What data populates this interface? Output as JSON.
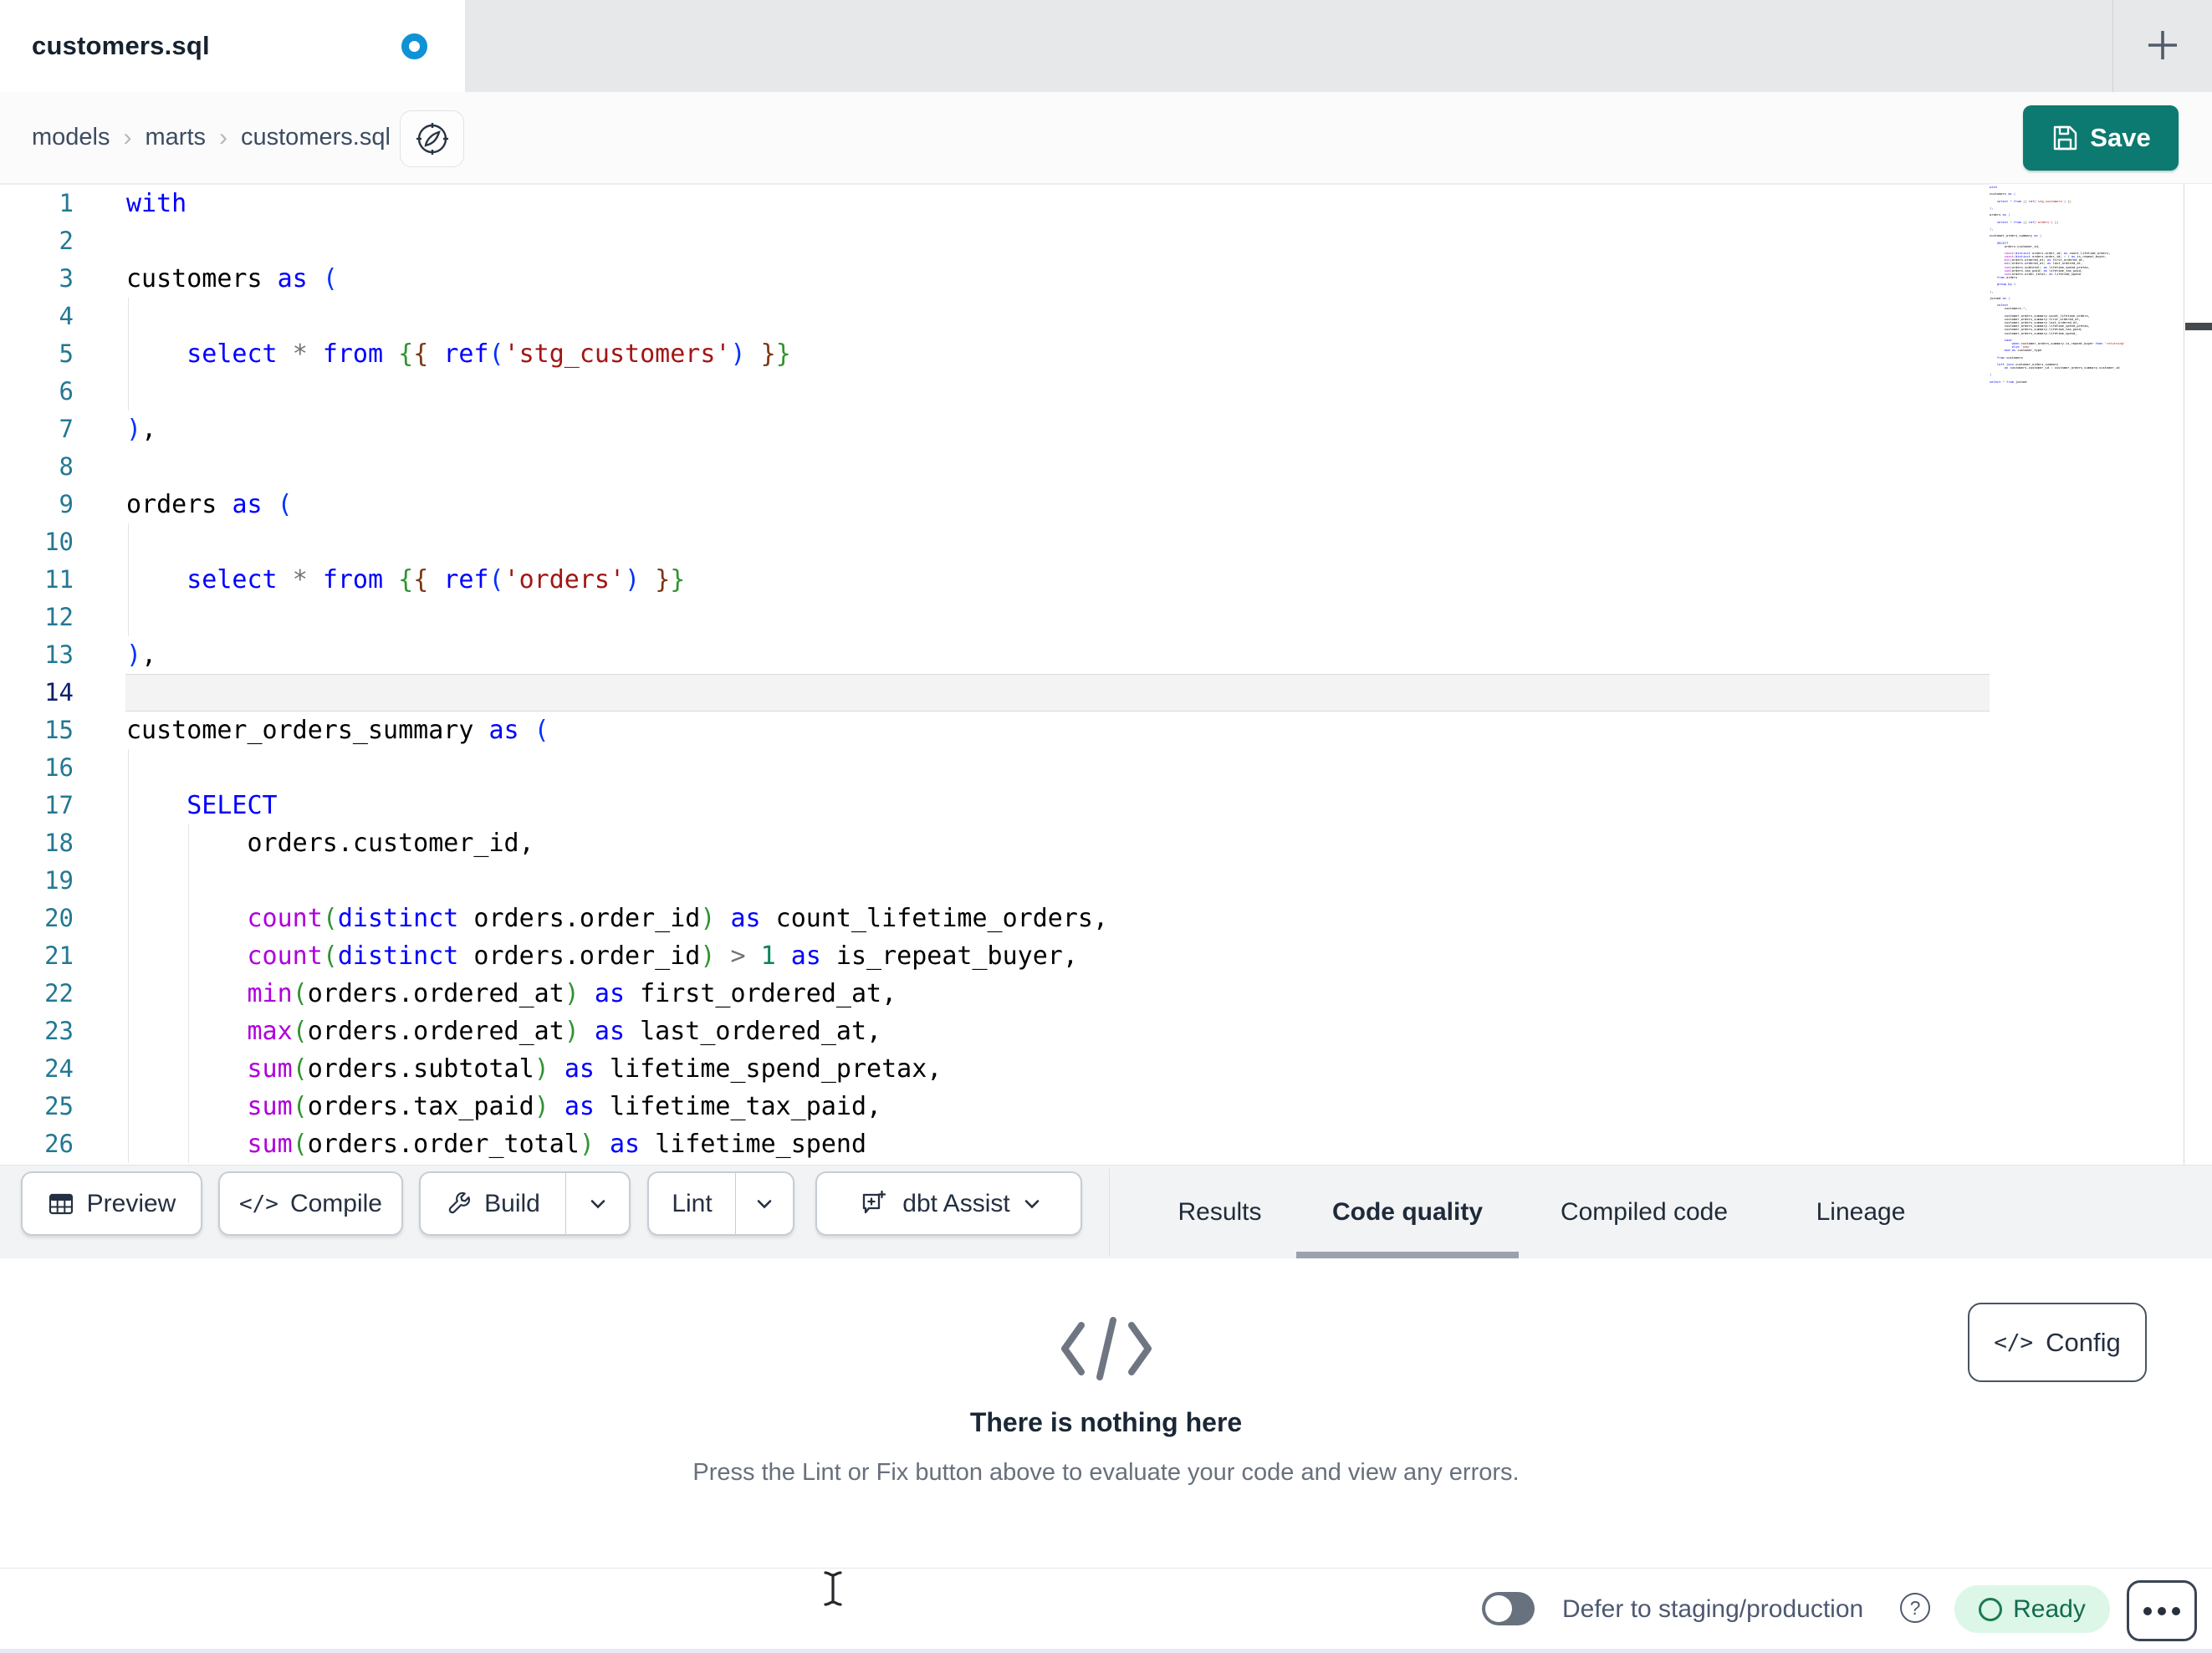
{
  "tabbar": {
    "tab_title": "customers.sql"
  },
  "breadcrumb": {
    "items": [
      "models",
      "marts",
      "customers.sql"
    ],
    "separator": "›"
  },
  "save_button": {
    "label": "Save"
  },
  "toolbar": {
    "preview_label": "Preview",
    "compile_label": "Compile",
    "compile_glyph": "</>",
    "build_label": "Build",
    "lint_label": "Lint",
    "assist_label": "dbt Assist"
  },
  "tabs": [
    {
      "label": "Results",
      "active": false
    },
    {
      "label": "Code quality",
      "active": true
    },
    {
      "label": "Compiled code",
      "active": false
    },
    {
      "label": "Lineage",
      "active": false
    }
  ],
  "empty_state": {
    "title": "There is nothing here",
    "subtitle": "Press the Lint or Fix button above to evaluate your code and view any errors."
  },
  "config_button": {
    "label": "Config",
    "glyph": "</>"
  },
  "statusbar": {
    "defer_label": "Defer to staging/production",
    "help_glyph": "?",
    "ready_label": "Ready"
  },
  "colors": {
    "accent_teal": "#0c7a70",
    "dirty_dot_blue": "#0f93d6",
    "ready_bg": "#dcf7e7",
    "ready_text": "#116b50",
    "active_tab_underline": "#9aa2ac",
    "line_number": "#237893",
    "active_line_number": "#0b216f"
  },
  "editor": {
    "token_colors": {
      "kw": "#0000ff",
      "fn": "#af00db",
      "str": "#a31515",
      "num": "#098658",
      "op": "#737373",
      "id": "#000000",
      "b1": "#0431fa",
      "b2": "#319331",
      "b3": "#7b3814"
    },
    "lines": [
      {
        "n": 1,
        "g": 0,
        "t": [
          [
            "kw",
            "with"
          ]
        ]
      },
      {
        "n": 2,
        "g": 0,
        "t": []
      },
      {
        "n": 3,
        "g": 0,
        "t": [
          [
            "id",
            "customers "
          ],
          [
            "kw",
            "as"
          ],
          [
            "id",
            " "
          ],
          [
            "b1",
            "("
          ]
        ]
      },
      {
        "n": 4,
        "g": 1,
        "t": []
      },
      {
        "n": 5,
        "g": 1,
        "t": [
          [
            "id",
            "    "
          ],
          [
            "kw",
            "select"
          ],
          [
            "id",
            " "
          ],
          [
            "op",
            "*"
          ],
          [
            "id",
            " "
          ],
          [
            "kw",
            "from"
          ],
          [
            "id",
            " "
          ],
          [
            "b2",
            "{"
          ],
          [
            "b3",
            "{"
          ],
          [
            "id",
            " "
          ],
          [
            "kw",
            "ref"
          ],
          [
            "b1",
            "("
          ],
          [
            "str",
            "'stg_customers'"
          ],
          [
            "b1",
            ")"
          ],
          [
            "id",
            " "
          ],
          [
            "b3",
            "}"
          ],
          [
            "b2",
            "}"
          ]
        ]
      },
      {
        "n": 6,
        "g": 1,
        "t": []
      },
      {
        "n": 7,
        "g": 0,
        "t": [
          [
            "b1",
            ")"
          ],
          [
            "id",
            ","
          ]
        ]
      },
      {
        "n": 8,
        "g": 0,
        "t": []
      },
      {
        "n": 9,
        "g": 0,
        "t": [
          [
            "id",
            "orders "
          ],
          [
            "kw",
            "as"
          ],
          [
            "id",
            " "
          ],
          [
            "b1",
            "("
          ]
        ]
      },
      {
        "n": 10,
        "g": 1,
        "t": []
      },
      {
        "n": 11,
        "g": 1,
        "t": [
          [
            "id",
            "    "
          ],
          [
            "kw",
            "select"
          ],
          [
            "id",
            " "
          ],
          [
            "op",
            "*"
          ],
          [
            "id",
            " "
          ],
          [
            "kw",
            "from"
          ],
          [
            "id",
            " "
          ],
          [
            "b2",
            "{"
          ],
          [
            "b3",
            "{"
          ],
          [
            "id",
            " "
          ],
          [
            "kw",
            "ref"
          ],
          [
            "b1",
            "("
          ],
          [
            "str",
            "'orders'"
          ],
          [
            "b1",
            ")"
          ],
          [
            "id",
            " "
          ],
          [
            "b3",
            "}"
          ],
          [
            "b2",
            "}"
          ]
        ]
      },
      {
        "n": 12,
        "g": 1,
        "t": []
      },
      {
        "n": 13,
        "g": 0,
        "t": [
          [
            "b1",
            ")"
          ],
          [
            "id",
            ","
          ]
        ]
      },
      {
        "n": 14,
        "g": 0,
        "active": true,
        "t": []
      },
      {
        "n": 15,
        "g": 0,
        "t": [
          [
            "id",
            "customer_orders_summary "
          ],
          [
            "kw",
            "as"
          ],
          [
            "id",
            " "
          ],
          [
            "b1",
            "("
          ]
        ]
      },
      {
        "n": 16,
        "g": 1,
        "t": []
      },
      {
        "n": 17,
        "g": 1,
        "t": [
          [
            "id",
            "    "
          ],
          [
            "kw",
            "SELECT"
          ]
        ]
      },
      {
        "n": 18,
        "g": 2,
        "t": [
          [
            "id",
            "        orders.customer_id,"
          ]
        ]
      },
      {
        "n": 19,
        "g": 2,
        "t": []
      },
      {
        "n": 20,
        "g": 2,
        "t": [
          [
            "id",
            "        "
          ],
          [
            "fn",
            "count"
          ],
          [
            "b2",
            "("
          ],
          [
            "kw",
            "distinct"
          ],
          [
            "id",
            " orders.order_id"
          ],
          [
            "b2",
            ")"
          ],
          [
            "id",
            " "
          ],
          [
            "kw",
            "as"
          ],
          [
            "id",
            " count_lifetime_orders,"
          ]
        ]
      },
      {
        "n": 21,
        "g": 2,
        "t": [
          [
            "id",
            "        "
          ],
          [
            "fn",
            "count"
          ],
          [
            "b2",
            "("
          ],
          [
            "kw",
            "distinct"
          ],
          [
            "id",
            " orders.order_id"
          ],
          [
            "b2",
            ")"
          ],
          [
            "id",
            " "
          ],
          [
            "op",
            ">"
          ],
          [
            "id",
            " "
          ],
          [
            "num",
            "1"
          ],
          [
            "id",
            " "
          ],
          [
            "kw",
            "as"
          ],
          [
            "id",
            " is_repeat_buyer,"
          ]
        ]
      },
      {
        "n": 22,
        "g": 2,
        "t": [
          [
            "id",
            "        "
          ],
          [
            "fn",
            "min"
          ],
          [
            "b2",
            "("
          ],
          [
            "id",
            "orders.ordered_at"
          ],
          [
            "b2",
            ")"
          ],
          [
            "id",
            " "
          ],
          [
            "kw",
            "as"
          ],
          [
            "id",
            " first_ordered_at,"
          ]
        ]
      },
      {
        "n": 23,
        "g": 2,
        "t": [
          [
            "id",
            "        "
          ],
          [
            "fn",
            "max"
          ],
          [
            "b2",
            "("
          ],
          [
            "id",
            "orders.ordered_at"
          ],
          [
            "b2",
            ")"
          ],
          [
            "id",
            " "
          ],
          [
            "kw",
            "as"
          ],
          [
            "id",
            " last_ordered_at,"
          ]
        ]
      },
      {
        "n": 24,
        "g": 2,
        "t": [
          [
            "id",
            "        "
          ],
          [
            "fn",
            "sum"
          ],
          [
            "b2",
            "("
          ],
          [
            "id",
            "orders.subtotal"
          ],
          [
            "b2",
            ")"
          ],
          [
            "id",
            " "
          ],
          [
            "kw",
            "as"
          ],
          [
            "id",
            " lifetime_spend_pretax,"
          ]
        ]
      },
      {
        "n": 25,
        "g": 2,
        "t": [
          [
            "id",
            "        "
          ],
          [
            "fn",
            "sum"
          ],
          [
            "b2",
            "("
          ],
          [
            "id",
            "orders.tax_paid"
          ],
          [
            "b2",
            ")"
          ],
          [
            "id",
            " "
          ],
          [
            "kw",
            "as"
          ],
          [
            "id",
            " lifetime_tax_paid,"
          ]
        ]
      },
      {
        "n": 26,
        "g": 2,
        "t": [
          [
            "id",
            "        "
          ],
          [
            "fn",
            "sum"
          ],
          [
            "b2",
            "("
          ],
          [
            "id",
            "orders.order_total"
          ],
          [
            "b2",
            ")"
          ],
          [
            "id",
            " "
          ],
          [
            "kw",
            "as"
          ],
          [
            "id",
            " lifetime_spend"
          ]
        ]
      }
    ],
    "minimap_extra": [
      {
        "t": [
          [
            "id",
            "    "
          ],
          [
            "kw",
            "from"
          ],
          [
            "id",
            " orders"
          ]
        ]
      },
      {
        "t": []
      },
      {
        "t": [
          [
            "id",
            "    "
          ],
          [
            "kw",
            "group"
          ],
          [
            "id",
            " "
          ],
          [
            "kw",
            "by"
          ],
          [
            "id",
            " "
          ],
          [
            "num",
            "1"
          ]
        ]
      },
      {
        "t": []
      },
      {
        "t": [
          [
            "b1",
            ")"
          ],
          [
            "id",
            ","
          ]
        ]
      },
      {
        "t": []
      },
      {
        "t": [
          [
            "id",
            "joined "
          ],
          [
            "kw",
            "as"
          ],
          [
            "id",
            " "
          ],
          [
            "b1",
            "("
          ]
        ]
      },
      {
        "t": []
      },
      {
        "t": [
          [
            "id",
            "    "
          ],
          [
            "kw",
            "select"
          ]
        ]
      },
      {
        "t": [
          [
            "id",
            "        customers."
          ],
          [
            "op",
            "*"
          ],
          [
            "id",
            ","
          ]
        ]
      },
      {
        "t": []
      },
      {
        "t": [
          [
            "id",
            "        customer_orders_summary.count_lifetime_orders,"
          ]
        ]
      },
      {
        "t": [
          [
            "id",
            "        customer_orders_summary.first_ordered_at,"
          ]
        ]
      },
      {
        "t": [
          [
            "id",
            "        customer_orders_summary.last_ordered_at,"
          ]
        ]
      },
      {
        "t": [
          [
            "id",
            "        customer_orders_summary.lifetime_spend_pretax,"
          ]
        ]
      },
      {
        "t": [
          [
            "id",
            "        customer_orders_summary.lifetime_tax_paid,"
          ]
        ]
      },
      {
        "t": [
          [
            "id",
            "        customer_orders_summary.lifetime_spend,"
          ]
        ]
      },
      {
        "t": []
      },
      {
        "t": [
          [
            "id",
            "        "
          ],
          [
            "kw",
            "case"
          ]
        ]
      },
      {
        "t": [
          [
            "id",
            "            "
          ],
          [
            "kw",
            "when"
          ],
          [
            "id",
            " customer_orders_summary.is_repeat_buyer "
          ],
          [
            "kw",
            "then"
          ],
          [
            "id",
            " "
          ],
          [
            "str",
            "'returning'"
          ]
        ]
      },
      {
        "t": [
          [
            "id",
            "            "
          ],
          [
            "kw",
            "else"
          ],
          [
            "id",
            " "
          ],
          [
            "str",
            "'new'"
          ]
        ]
      },
      {
        "t": [
          [
            "id",
            "        "
          ],
          [
            "kw",
            "end"
          ],
          [
            "id",
            " "
          ],
          [
            "kw",
            "as"
          ],
          [
            "id",
            " customer_type"
          ]
        ]
      },
      {
        "t": []
      },
      {
        "t": [
          [
            "id",
            "    "
          ],
          [
            "kw",
            "from"
          ],
          [
            "id",
            " customers"
          ]
        ]
      },
      {
        "t": []
      },
      {
        "t": [
          [
            "id",
            "    "
          ],
          [
            "kw",
            "left"
          ],
          [
            "id",
            " "
          ],
          [
            "kw",
            "join"
          ],
          [
            "id",
            " customer_orders_summary"
          ]
        ]
      },
      {
        "t": [
          [
            "id",
            "        "
          ],
          [
            "kw",
            "on"
          ],
          [
            "id",
            " customers.customer_id "
          ],
          [
            "op",
            "="
          ],
          [
            "id",
            " customer_orders_summary.customer_id"
          ]
        ]
      },
      {
        "t": []
      },
      {
        "t": [
          [
            "b1",
            ")"
          ]
        ]
      },
      {
        "t": []
      },
      {
        "t": [
          [
            "kw",
            "select"
          ],
          [
            "id",
            " "
          ],
          [
            "op",
            "*"
          ],
          [
            "id",
            " "
          ],
          [
            "kw",
            "from"
          ],
          [
            "id",
            " joined"
          ]
        ]
      }
    ]
  }
}
